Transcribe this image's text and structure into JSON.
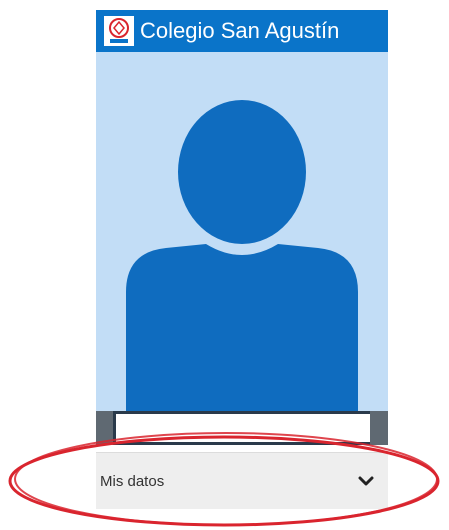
{
  "header": {
    "title": "Colegio San Agustín",
    "logo_icon": "school-crest-icon"
  },
  "profile": {
    "avatar_icon": "user-silhouette-icon"
  },
  "menu": {
    "mis_datos_label": "Mis datos",
    "expand_icon": "chevron-down-icon"
  },
  "colors": {
    "brand_blue": "#0a74c9",
    "avatar_blue": "#0f6cbf",
    "photo_background": "#c2ddf6",
    "highlight_red": "#d9252e"
  }
}
